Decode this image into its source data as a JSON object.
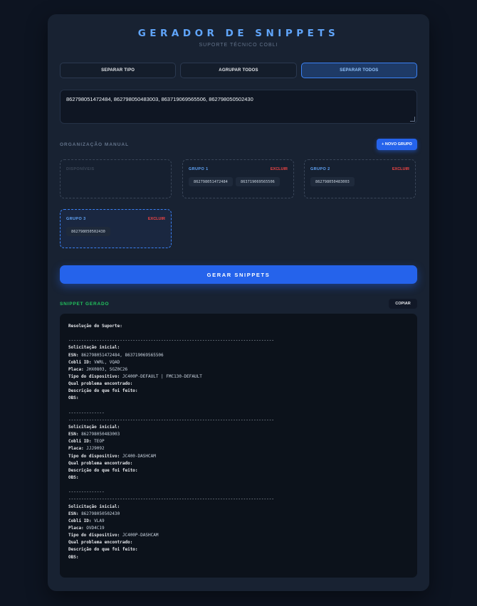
{
  "header": {
    "title": "GERADOR DE SNIPPETS",
    "subtitle": "SUPORTE TÉCNICO COBLI"
  },
  "modes": [
    {
      "label": "SEPARAR TIPO",
      "active": false
    },
    {
      "label": "AGRUPAR TODOS",
      "active": false
    },
    {
      "label": "SEPARAR TODOS",
      "active": true
    }
  ],
  "esn_input": {
    "value": "862798051472484, 862798050483003, 863719069565506, 862798050502430"
  },
  "manual": {
    "label": "ORGANIZAÇÃO MANUAL",
    "new_group_label": "+ NOVO GRUPO",
    "available_label": "DISPONÍVEIS",
    "groups": [
      {
        "title": "GRUPO 1",
        "delete_label": "EXCLUIR",
        "esns": [
          "862798051472484",
          "863719069565506"
        ]
      },
      {
        "title": "GRUPO 2",
        "delete_label": "EXCLUIR",
        "esns": [
          "862798050483003"
        ]
      },
      {
        "title": "GRUPO 3",
        "delete_label": "EXCLUIR",
        "esns": [
          "862798050502430"
        ]
      }
    ]
  },
  "generate_label": "GERAR SNIPPETS",
  "snippet": {
    "label": "SNIPPET GERADO",
    "copy_label": "COPIAR",
    "lines": [
      {
        "key": "Resolução do Suporte:",
        "value": ""
      },
      {
        "key": "",
        "value": ""
      },
      {
        "key": "",
        "value": "--------------------------------------------------------------------------------"
      },
      {
        "key": "Solicitação inicial:",
        "value": ""
      },
      {
        "key": "ESN:",
        "value": " 862798051472484, 863719069565506"
      },
      {
        "key": "Cobli ID:",
        "value": " VWRL, VQAD"
      },
      {
        "key": "Placa:",
        "value": " JHX0803, SGZ0C26"
      },
      {
        "key": "Tipo do dispositivo:",
        "value": " JC400P-DEFAULT | FMC130-DEFAULT"
      },
      {
        "key": "Qual problema encontrado:",
        "value": ""
      },
      {
        "key": "Descrição do que foi feito:",
        "value": ""
      },
      {
        "key": "OBS:",
        "value": ""
      },
      {
        "key": "",
        "value": ""
      },
      {
        "key": "",
        "value": "--------------"
      },
      {
        "key": "",
        "value": "--------------------------------------------------------------------------------"
      },
      {
        "key": "Solicitação inicial:",
        "value": ""
      },
      {
        "key": "ESN:",
        "value": " 862798050483003"
      },
      {
        "key": "Cobli ID:",
        "value": " TEOP"
      },
      {
        "key": "Placa:",
        "value": " JJJ9092"
      },
      {
        "key": "Tipo do dispositivo:",
        "value": " JC400-DASHCAM"
      },
      {
        "key": "Qual problema encontrado:",
        "value": ""
      },
      {
        "key": "Descrição do que foi feito:",
        "value": ""
      },
      {
        "key": "OBS:",
        "value": ""
      },
      {
        "key": "",
        "value": ""
      },
      {
        "key": "",
        "value": "--------------"
      },
      {
        "key": "",
        "value": "--------------------------------------------------------------------------------"
      },
      {
        "key": "Solicitação inicial:",
        "value": ""
      },
      {
        "key": "ESN:",
        "value": " 862798050502430"
      },
      {
        "key": "Cobli ID:",
        "value": " VLA9"
      },
      {
        "key": "Placa:",
        "value": " OVD4C19"
      },
      {
        "key": "Tipo do dispositivo:",
        "value": " JC400P-DASHCAM"
      },
      {
        "key": "Qual problema encontrado:",
        "value": ""
      },
      {
        "key": "Descrição do que foi feito:",
        "value": ""
      },
      {
        "key": "OBS:",
        "value": ""
      }
    ]
  },
  "colors": {
    "accent": "#2563eb",
    "title": "#60a5fa",
    "danger": "#ef4444",
    "success": "#22c55e"
  }
}
